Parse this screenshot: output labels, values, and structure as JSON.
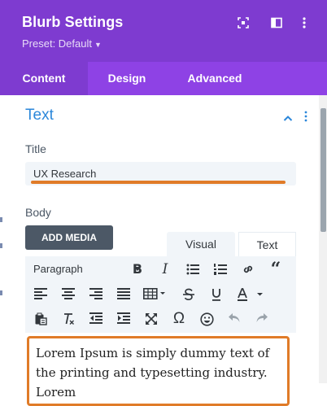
{
  "header": {
    "title": "Blurb Settings",
    "preset_label": "Preset: Default",
    "background": "#7e3bd0",
    "icons": [
      "focus-icon",
      "sidebar-toggle-icon",
      "more-vertical-icon"
    ]
  },
  "tabs": [
    {
      "label": "Content",
      "active": true
    },
    {
      "label": "Design",
      "active": false
    },
    {
      "label": "Advanced",
      "active": false
    }
  ],
  "section": {
    "title": "Text",
    "title_color": "#2b87da"
  },
  "title_field": {
    "label": "Title",
    "value": "UX Research",
    "highlight_color": "#e07b28"
  },
  "body_field": {
    "label": "Body",
    "add_media_label": "ADD MEDIA",
    "editor_tabs": [
      {
        "label": "Visual",
        "active": true
      },
      {
        "label": "Text",
        "active": false
      }
    ],
    "format_select": "Paragraph",
    "toolbar_icons": [
      "bold-icon",
      "italic-icon",
      "bullet-list-icon",
      "numbered-list-icon",
      "link-icon",
      "blockquote-icon",
      "align-left-icon",
      "align-center-icon",
      "align-right-icon",
      "align-justify-icon",
      "table-icon",
      "strikethrough-icon",
      "underline-icon",
      "text-color-icon",
      "paste-text-icon",
      "clear-formatting-icon",
      "outdent-icon",
      "indent-icon",
      "fullscreen-icon",
      "special-character-icon",
      "emoji-icon",
      "undo-icon",
      "redo-icon"
    ],
    "content": "Lorem Ipsum is simply dummy text of the printing and typesetting industry. Lorem"
  }
}
